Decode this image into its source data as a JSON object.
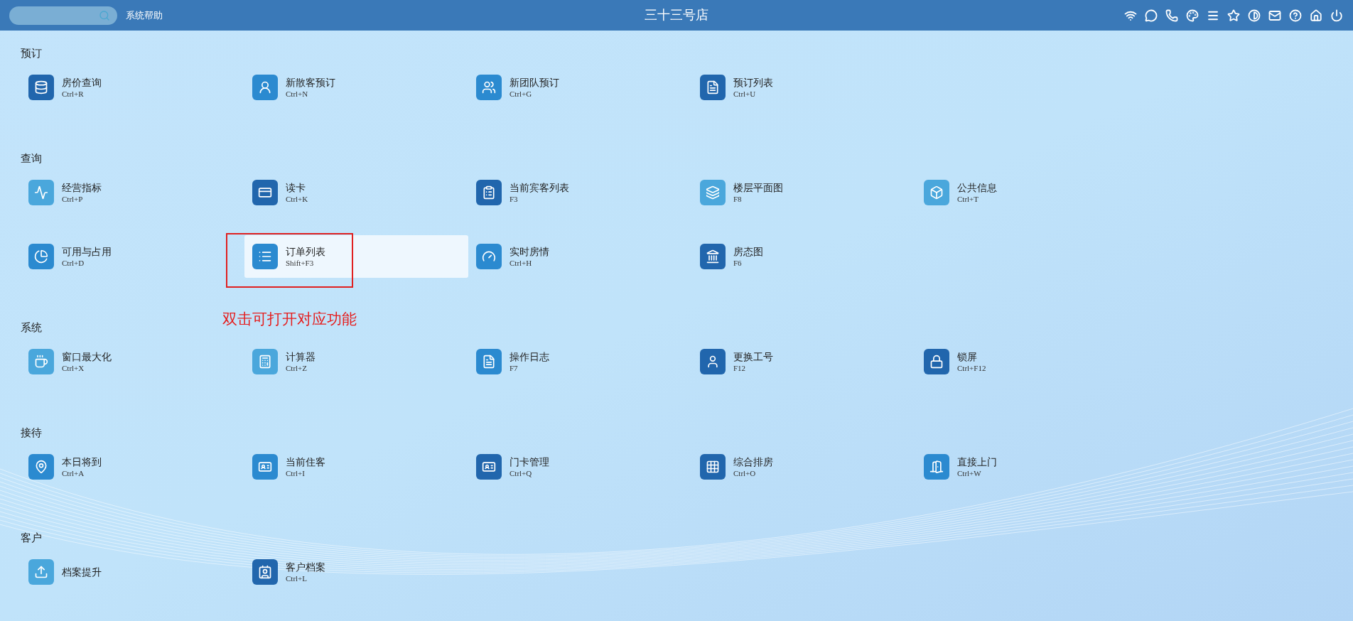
{
  "topbar": {
    "help_link": "系统帮助",
    "title": "三十三号店"
  },
  "sections": [
    {
      "title": "预订",
      "items": [
        {
          "label": "房价查询",
          "shortcut": "Ctrl+R",
          "color": "#2166ad",
          "selected": false
        },
        {
          "label": "新散客预订",
          "shortcut": "Ctrl+N",
          "color": "#2b8ad0",
          "selected": false
        },
        {
          "label": "新团队预订",
          "shortcut": "Ctrl+G",
          "color": "#2b8ad0",
          "selected": false
        },
        {
          "label": "预订列表",
          "shortcut": "Ctrl+U",
          "color": "#2166ad",
          "selected": false
        }
      ]
    },
    {
      "title": "查询",
      "items": [
        {
          "label": "经营指标",
          "shortcut": "Ctrl+P",
          "color": "#4aa7dc",
          "selected": false
        },
        {
          "label": "读卡",
          "shortcut": "Ctrl+K",
          "color": "#2166ad",
          "selected": false
        },
        {
          "label": "当前宾客列表",
          "shortcut": "F3",
          "color": "#2166ad",
          "selected": false
        },
        {
          "label": "楼层平面图",
          "shortcut": "F8",
          "color": "#4aa7dc",
          "selected": false
        },
        {
          "label": "公共信息",
          "shortcut": "Ctrl+T",
          "color": "#4aa7dc",
          "selected": false
        },
        {
          "label": "可用与占用",
          "shortcut": "Ctrl+D",
          "color": "#2b8ad0",
          "selected": false
        },
        {
          "label": "订单列表",
          "shortcut": "Shift+F3",
          "color": "#2b8ad0",
          "selected": true
        },
        {
          "label": "实时房情",
          "shortcut": "Ctrl+H",
          "color": "#2b8ad0",
          "selected": false
        },
        {
          "label": "房态图",
          "shortcut": "F6",
          "color": "#2166ad",
          "selected": false
        }
      ]
    },
    {
      "title": "系统",
      "items": [
        {
          "label": "窗口最大化",
          "shortcut": "Ctrl+X",
          "color": "#4aa7dc",
          "selected": false
        },
        {
          "label": "计算器",
          "shortcut": "Ctrl+Z",
          "color": "#4aa7dc",
          "selected": false
        },
        {
          "label": "操作日志",
          "shortcut": "F7",
          "color": "#2b8ad0",
          "selected": false
        },
        {
          "label": "更换工号",
          "shortcut": "F12",
          "color": "#2166ad",
          "selected": false
        },
        {
          "label": "锁屏",
          "shortcut": "Ctrl+F12",
          "color": "#2166ad",
          "selected": false
        }
      ]
    },
    {
      "title": "接待",
      "items": [
        {
          "label": "本日将到",
          "shortcut": "Ctrl+A",
          "color": "#2b8ad0",
          "selected": false
        },
        {
          "label": "当前住客",
          "shortcut": "Ctrl+I",
          "color": "#2b8ad0",
          "selected": false
        },
        {
          "label": "门卡管理",
          "shortcut": "Ctrl+Q",
          "color": "#2166ad",
          "selected": false
        },
        {
          "label": "综合排房",
          "shortcut": "Ctrl+O",
          "color": "#2166ad",
          "selected": false
        },
        {
          "label": "直接上门",
          "shortcut": "Ctrl+W",
          "color": "#2b8ad0",
          "selected": false
        }
      ]
    },
    {
      "title": "客户",
      "items": [
        {
          "label": "档案提升",
          "color": "#4aa7dc",
          "selected": false
        },
        {
          "label": "客户档案",
          "shortcut": "Ctrl+L",
          "color": "#2166ad",
          "selected": false
        }
      ]
    }
  ],
  "annotation": {
    "text": "双击可打开对应功能"
  }
}
